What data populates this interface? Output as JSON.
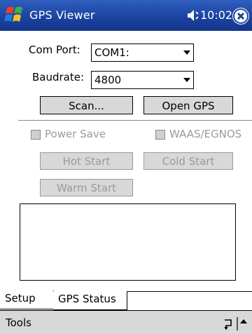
{
  "titlebar": {
    "app_title": "GPS Viewer",
    "time": "10:02",
    "icons": {
      "start": "windows-flag-icon",
      "volume": "speaker-icon",
      "close": "close-icon"
    },
    "colors": {
      "bar": "#1c43a0",
      "text": "#ffffff"
    }
  },
  "form": {
    "com_port": {
      "label": "Com Port:",
      "value": "COM1:"
    },
    "baudrate": {
      "label": "Baudrate:",
      "value": "4800"
    },
    "scan_label": "Scan...",
    "open_gps_label": "Open GPS",
    "power_save_label": "Power Save",
    "waas_label": "WAAS/EGNOS",
    "hot_start_label": "Hot Start",
    "cold_start_label": "Cold Start",
    "warm_start_label": "Warm Start",
    "log_text": ""
  },
  "tabs": [
    {
      "label": "Setup",
      "active": true
    },
    {
      "label": "GPS Status",
      "active": false
    }
  ],
  "menubar": {
    "tools_label": "Tools",
    "input_icon": "keyboard-toggle-icon"
  }
}
